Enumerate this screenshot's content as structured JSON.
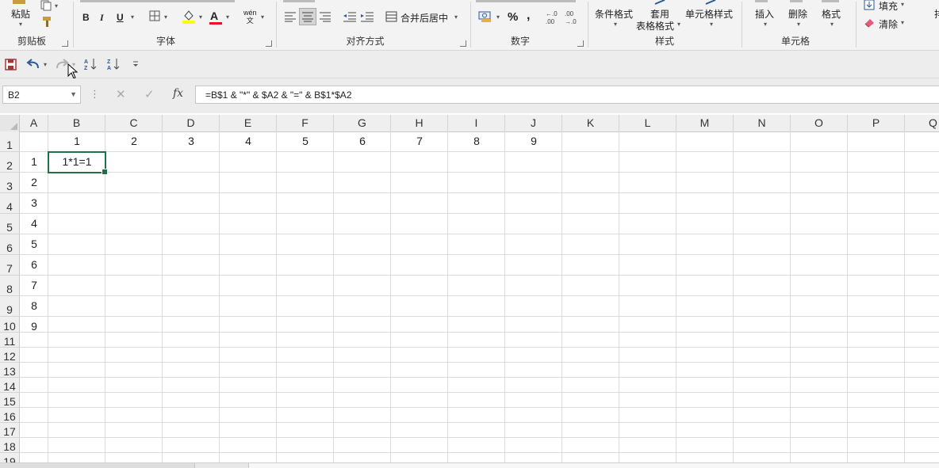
{
  "ribbon": {
    "clipboard": {
      "label": "剪贴板",
      "paste_label": "粘贴"
    },
    "font": {
      "label": "字体",
      "bold": "B",
      "italic": "I",
      "underline": "U",
      "font_color_glyph": "A",
      "phonetic_top": "wén",
      "phonetic_bottom": "文"
    },
    "alignment": {
      "label": "对齐方式",
      "merge_label": "合并后居中"
    },
    "number": {
      "label": "数字",
      "percent": "%",
      "comma": ",",
      "inc_decimal": "←.0\n.00",
      "dec_decimal": ".00\n→.0"
    },
    "styles": {
      "label": "样式",
      "conditional": "条件格式",
      "table_top": "套用",
      "table_bottom": "表格格式",
      "cell_styles": "单元格样式"
    },
    "cells": {
      "label": "单元格",
      "insert": "插入",
      "delete": "删除",
      "format": "格式"
    },
    "editing": {
      "fill": "填充",
      "clear": "清除",
      "sort_cut": "排"
    }
  },
  "formula_bar": {
    "name_box": "B2",
    "formula": "=B$1 & \"*\" & $A2 & \"=\" & B$1*$A2",
    "fx_label": "fx"
  },
  "grid": {
    "columns": [
      "A",
      "B",
      "C",
      "D",
      "E",
      "F",
      "G",
      "H",
      "I",
      "J",
      "K",
      "L",
      "M",
      "N",
      "O",
      "P",
      "Q"
    ],
    "rows": [
      "1",
      "2",
      "3",
      "4",
      "5",
      "6",
      "7",
      "8",
      "9",
      "10",
      "11",
      "12",
      "13",
      "14",
      "15",
      "16",
      "17",
      "18",
      "19"
    ],
    "row1_values": [
      "1",
      "2",
      "3",
      "4",
      "5",
      "6",
      "7",
      "8",
      "9"
    ],
    "colA_values": [
      "1",
      "2",
      "3",
      "4",
      "5",
      "6",
      "7",
      "8",
      "9"
    ],
    "b2_value": "1*1=1",
    "selected_cell": "B2"
  },
  "colors": {
    "selection": "#1e7145",
    "undo_icon": "#2b579a",
    "save_icon": "#a4373a",
    "fill_highlight": "#ffff00",
    "font_color": "#e81123"
  }
}
